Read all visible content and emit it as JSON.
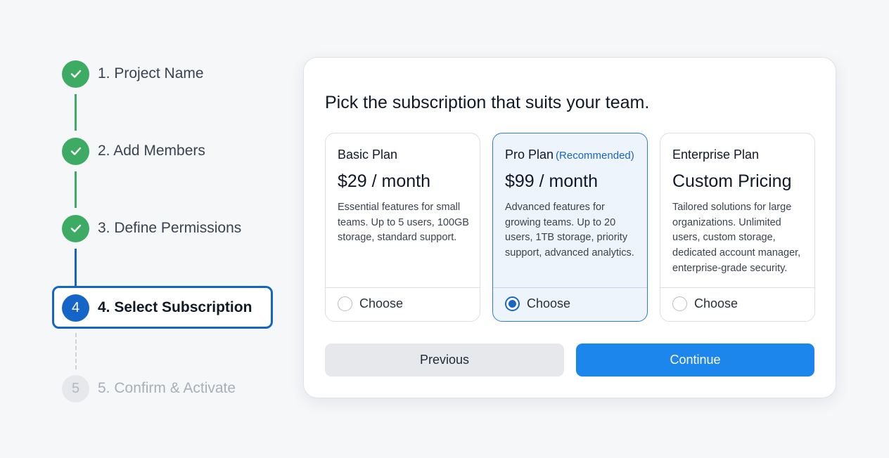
{
  "stepper": {
    "steps": [
      {
        "label": "1. Project Name",
        "status": "done",
        "icon": "check-icon"
      },
      {
        "label": "2. Add Members",
        "status": "done",
        "icon": "check-icon"
      },
      {
        "label": "3. Define Permissions",
        "status": "done",
        "icon": "check-icon"
      },
      {
        "number": "4",
        "label": "4. Select Subscription",
        "status": "active"
      },
      {
        "number": "5",
        "label": "5. Confirm & Activate",
        "status": "pending"
      }
    ]
  },
  "main": {
    "title": "Pick the subscription that suits your team.",
    "plans": [
      {
        "name": "Basic Plan",
        "badge": "",
        "price": "$29 / month",
        "description": "Essential features for small teams. Up to 5 users, 100GB storage, standard support.",
        "choose_label": "Choose",
        "selected": false
      },
      {
        "name": "Pro Plan",
        "badge": "(Recommended)",
        "price": "$99 / month",
        "description": "Advanced features for growing teams. Up to 20 users, 1TB storage, priority support, advanced analytics.",
        "choose_label": "Choose",
        "selected": true
      },
      {
        "name": "Enterprise Plan",
        "badge": "",
        "price": "Custom Pricing",
        "description": "Tailored solutions for large organizations. Unlimited users, custom storage, dedicated account manager, enterprise-grade security.",
        "choose_label": "Choose",
        "selected": false
      }
    ],
    "buttons": {
      "previous_label": "Previous",
      "continue_label": "Continue"
    }
  },
  "colors": {
    "done": "#3dab63",
    "active": "#1565c8",
    "pending": "#e6e8eb",
    "primary_button": "#1d86ed",
    "selected_plan_bg": "#edf4fc"
  }
}
